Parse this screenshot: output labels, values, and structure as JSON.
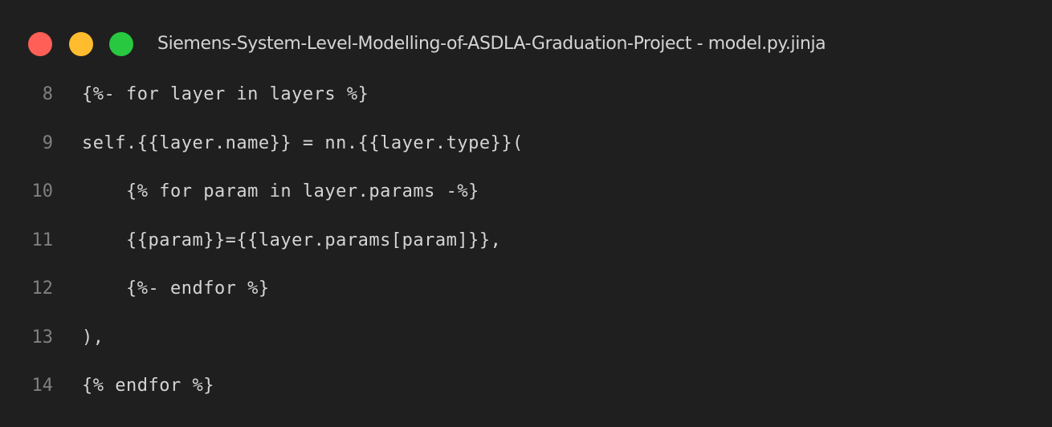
{
  "window": {
    "title": "Siemens-System-Level-Modelling-of-ASDLA-Graduation-Project - model.py.jinja",
    "controls": [
      {
        "name": "close",
        "color": "#ff5f57"
      },
      {
        "name": "minimize",
        "color": "#febc2e"
      },
      {
        "name": "zoom",
        "color": "#28c840"
      }
    ]
  },
  "editor": {
    "lines": [
      {
        "number": "8",
        "text": "{%- for layer in layers %}"
      },
      {
        "number": "9",
        "text": "self.{{layer.name}} = nn.{{layer.type}}("
      },
      {
        "number": "10",
        "text": "    {% for param in layer.params -%}"
      },
      {
        "number": "11",
        "text": "    {{param}}={{layer.params[param]}},"
      },
      {
        "number": "12",
        "text": "    {%- endfor %}"
      },
      {
        "number": "13",
        "text": "),"
      },
      {
        "number": "14",
        "text": "{% endfor %}"
      }
    ]
  },
  "colors": {
    "background": "#1f1f1f",
    "text": "#d4d4d4",
    "line_number": "#808080"
  }
}
